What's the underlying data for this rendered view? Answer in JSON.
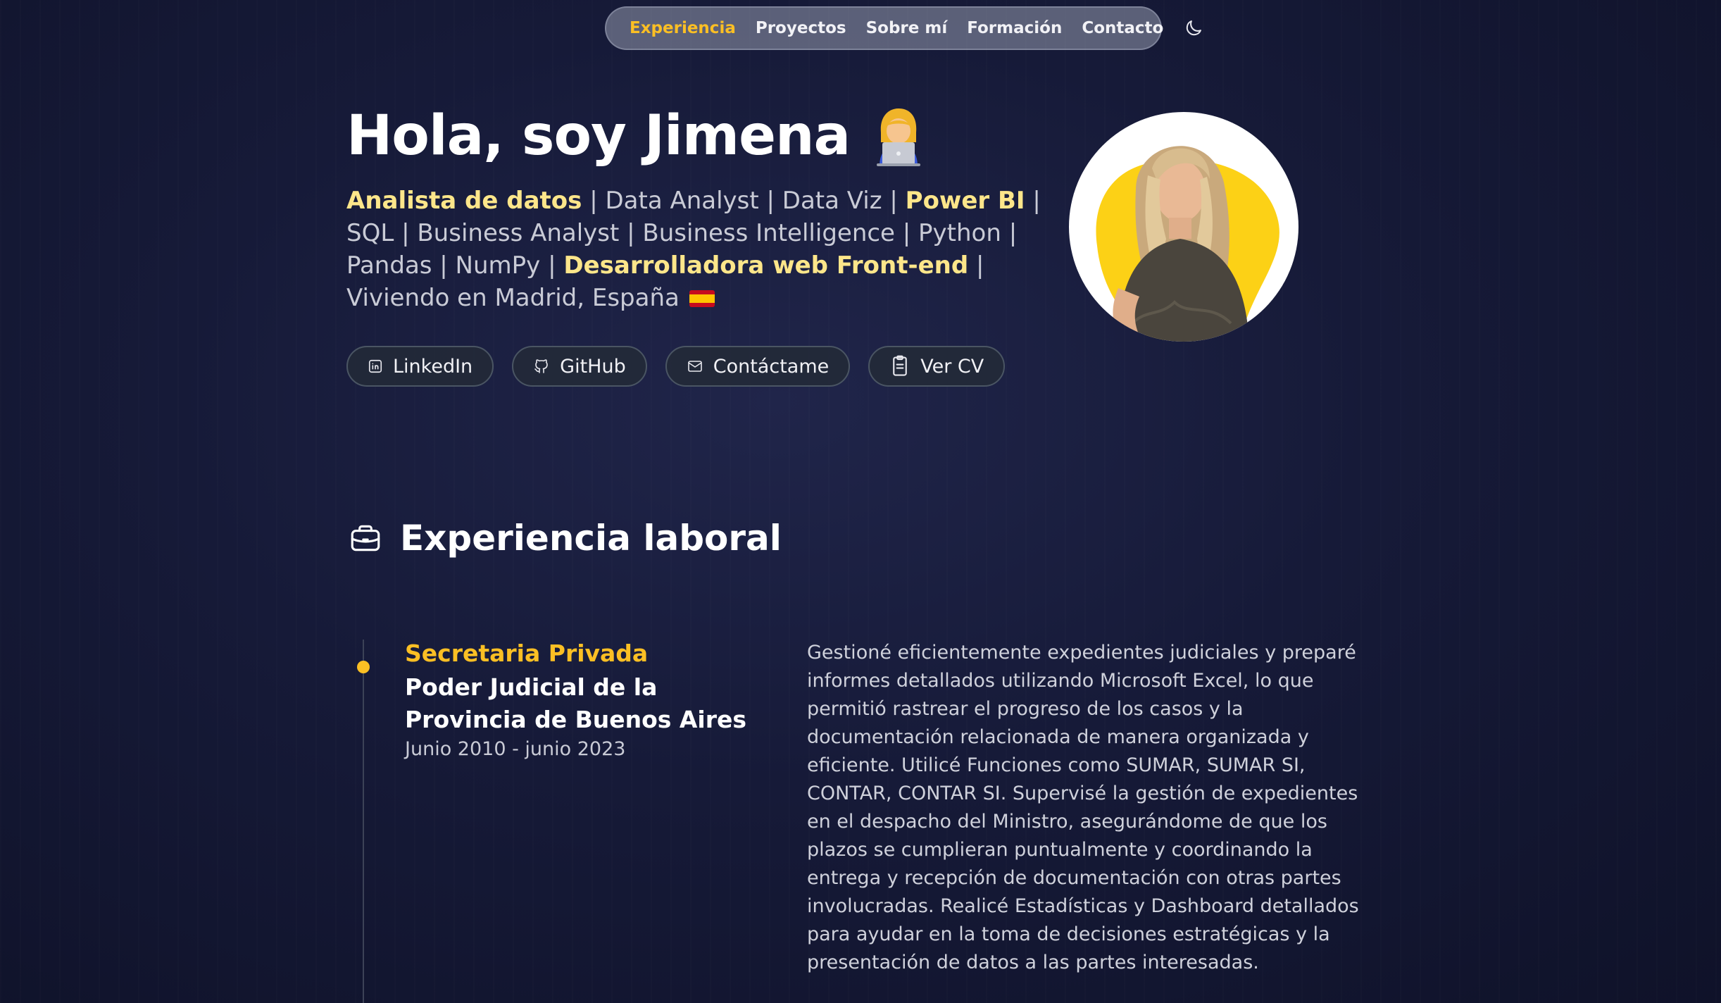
{
  "nav": {
    "items": [
      {
        "label": "Experiencia",
        "active": true
      },
      {
        "label": "Proyectos",
        "active": false
      },
      {
        "label": "Sobre mí",
        "active": false
      },
      {
        "label": "Formación",
        "active": false
      },
      {
        "label": "Contacto",
        "active": false
      }
    ],
    "theme_icon": "moon-icon"
  },
  "hero": {
    "title": "Hola, soy Jimena",
    "title_emoji": "woman-technologist-emoji",
    "subtitle": {
      "highlight_1": "Analista de datos",
      "text_1": " | Data Analyst | Data Viz | ",
      "highlight_2": "Power BI",
      "text_2": " | SQL | Business Analyst | Business Intelligence | Python | Pandas | NumPy | ",
      "highlight_3": "Desarrolladora web Front-end",
      "text_3": " | Viviendo en Madrid, España",
      "flag": "spain-flag"
    },
    "buttons": [
      {
        "label": "LinkedIn",
        "icon": "linkedin-icon"
      },
      {
        "label": "GitHub",
        "icon": "github-icon"
      },
      {
        "label": "Contáctame",
        "icon": "mail-icon"
      },
      {
        "label": "Ver CV",
        "icon": "clipboard-icon"
      }
    ],
    "avatar": "profile-photo"
  },
  "experience": {
    "section_title": "Experiencia laboral",
    "section_icon": "briefcase-icon",
    "jobs": [
      {
        "role": "Secretaria Privada",
        "company": "Poder Judicial de la Provincia de Buenos Aires",
        "dates": "Junio 2010 - junio 2023",
        "description": "Gestioné eficientemente expedientes judiciales y preparé informes detallados utilizando Microsoft Excel, lo que permitió rastrear el progreso de los casos y la documentación relacionada de manera organizada y eficiente. Utilicé Funciones como SUMAR, SUMAR SI, CONTAR, CONTAR SI. Supervisé la gestión de expedientes en el despacho del Ministro, asegurándome de que los plazos se cumplieran puntualmente y coordinando la entrega y recepción de documentación con otras partes involucradas. Realicé Estadísticas y Dashboard detallados para ayudar en la toma de decisiones estratégicas y la presentación de datos a las partes interesadas."
      }
    ]
  },
  "colors": {
    "accent": "#fbbf24",
    "highlight": "#fde68a",
    "background": "#161a38"
  }
}
